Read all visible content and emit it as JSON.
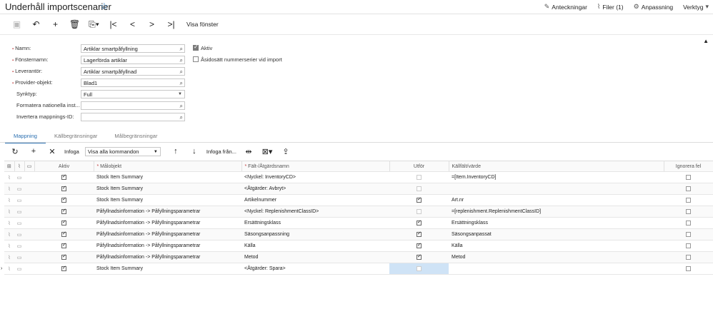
{
  "header": {
    "title": "Underhåll importscenarier",
    "links": [
      "Anteckningar",
      "Filer (1)",
      "Anpassning",
      "Verktyg"
    ]
  },
  "toolbar": {
    "visa_fonster": "Visa fönster"
  },
  "form": {
    "labels": {
      "namn": "Namn:",
      "fonsternamn": "Fönsternamn:",
      "leverantor": "Leverantör:",
      "provider": "Provider-objekt:",
      "synktyp": "Synktyp:",
      "formatera": "Formatera nationella inst...",
      "invertera": "Invertera mappnings-ID:"
    },
    "values": {
      "namn": "Artiklar smartpåfyllning",
      "fonsternamn": "Lagerförda artiklar",
      "leverantor": "Artiklar smartpåfyllnad",
      "provider": "Blad1",
      "synktyp": "Full",
      "formatera": "",
      "invertera": ""
    },
    "checkboxes": {
      "aktiv": "Aktiv",
      "asidosatt": "Åsidosätt nummerserier vid import"
    }
  },
  "tabs": [
    "Mappning",
    "Källbegränsningar",
    "Målbegränsningar"
  ],
  "grid_toolbar": {
    "infoga": "Infoga",
    "select": "Visa alla kommandon",
    "infoga_fran": "Infoga från..."
  },
  "grid": {
    "columns": [
      "Aktiv",
      "Målobjekt",
      "Fält-/Åtgärdsnamn",
      "Utför",
      "Källfält/värde",
      "Ignorera fel"
    ],
    "rows": [
      {
        "aktiv": true,
        "mal": "Stock Item Summary",
        "falt": "<Nyckel: InventoryCD>",
        "utfor": false,
        "kalla": "=[Item.InventoryCD]"
      },
      {
        "aktiv": true,
        "mal": "Stock Item Summary",
        "falt": "<Åtgärder: Avbryt>",
        "utfor": false,
        "kalla": ""
      },
      {
        "aktiv": true,
        "mal": "Stock Item Summary",
        "falt": "Artikelnummer",
        "utfor": true,
        "kalla": "Art.nr"
      },
      {
        "aktiv": true,
        "mal": "Påfyllnadsinformation -> Påfyllningsparametrar",
        "falt": "<Nyckel: ReplenishmentClassID>",
        "utfor": false,
        "kalla": "=[replenishment.ReplenishmentClassID]"
      },
      {
        "aktiv": true,
        "mal": "Påfyllnadsinformation -> Påfyllningsparametrar",
        "falt": "Ersättningsklass",
        "utfor": true,
        "kalla": "Ersättningsklass"
      },
      {
        "aktiv": true,
        "mal": "Påfyllnadsinformation -> Påfyllningsparametrar",
        "falt": "Säsongsanpassning",
        "utfor": true,
        "kalla": "Säsongsanpassat"
      },
      {
        "aktiv": true,
        "mal": "Påfyllnadsinformation -> Påfyllningsparametrar",
        "falt": "Källa",
        "utfor": true,
        "kalla": "Källa"
      },
      {
        "aktiv": true,
        "mal": "Påfyllnadsinformation -> Påfyllningsparametrar",
        "falt": "Metod",
        "utfor": true,
        "kalla": "Metod"
      },
      {
        "aktiv": true,
        "mal": "Stock Item Summary",
        "falt": "<Åtgärder: Spara>",
        "utfor": false,
        "kalla": ""
      }
    ]
  }
}
